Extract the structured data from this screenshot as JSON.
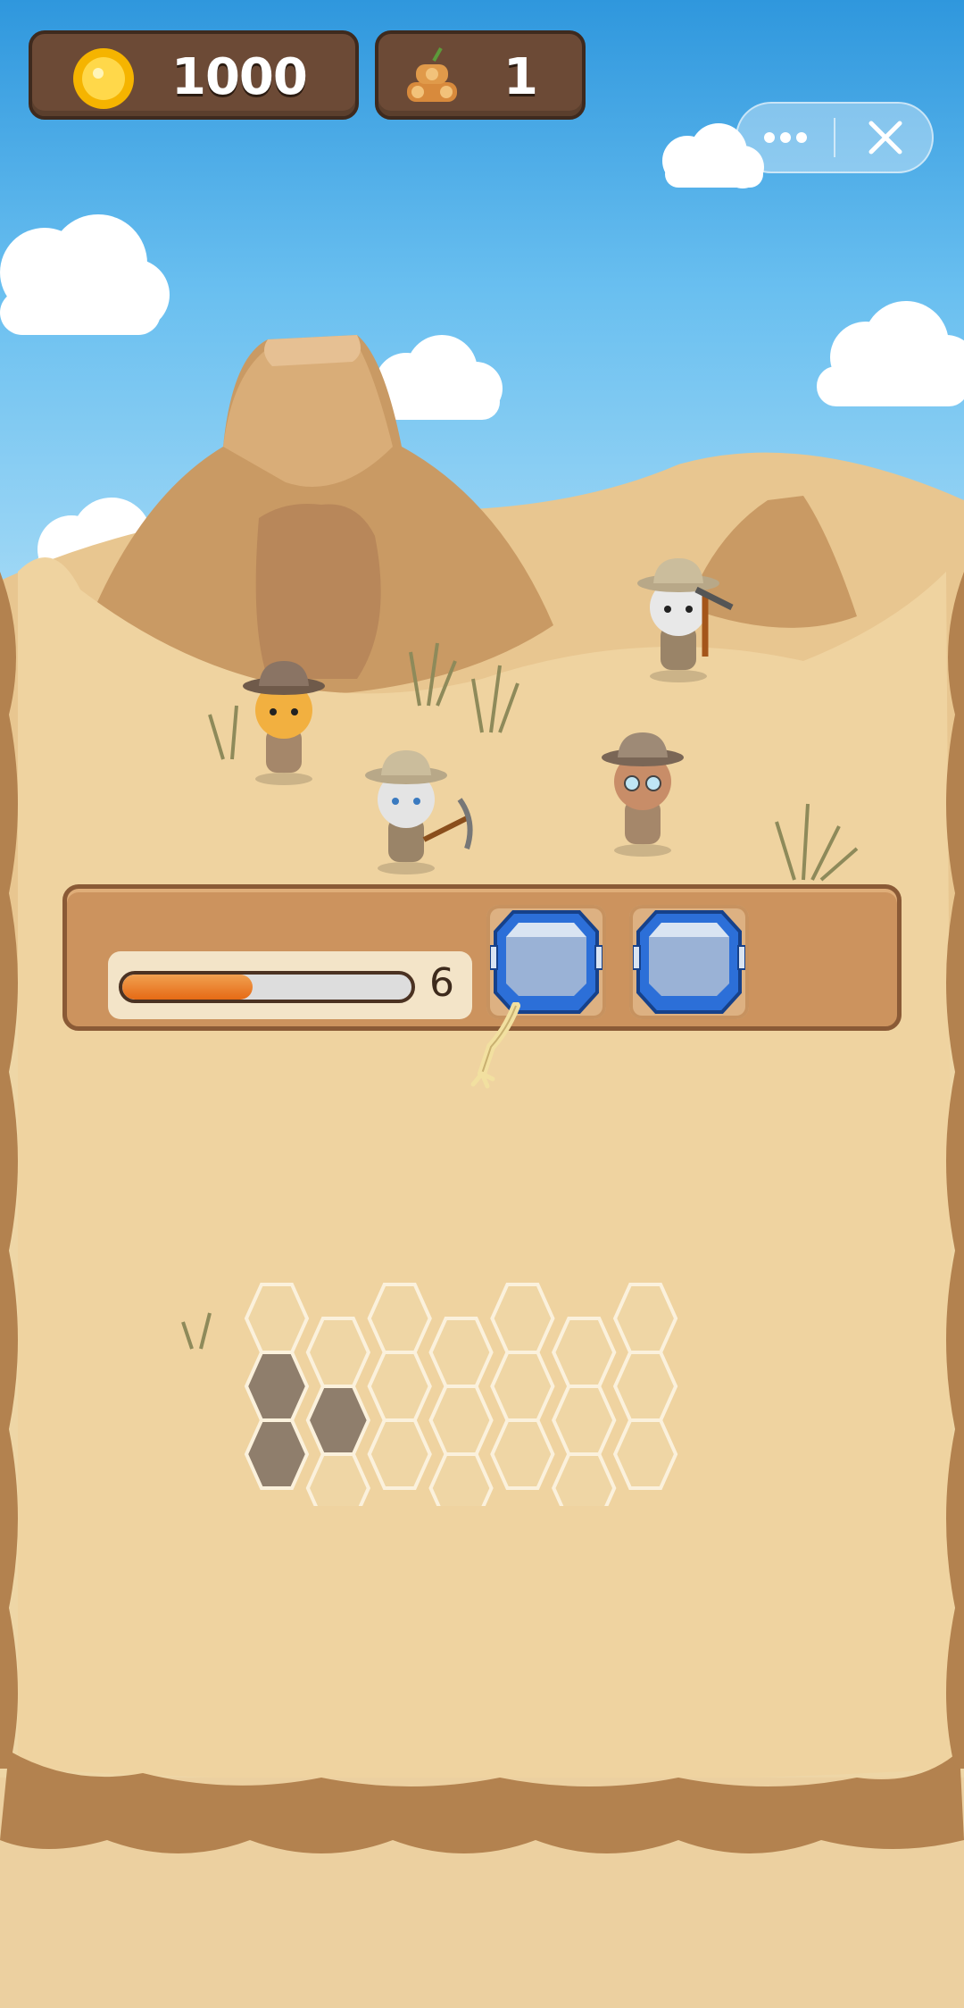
{
  "hud": {
    "coins": "1000",
    "coin_icon": "gold-coin-icon",
    "logs": "1",
    "log_icon": "wood-log-pile-icon"
  },
  "system_menu": {
    "more_icon": "more-dots-icon",
    "close_icon": "close-icon"
  },
  "dig_panel": {
    "progress": 0.45,
    "progress_count": "6",
    "slots": [
      {
        "item": "blue-crate-icon"
      },
      {
        "item": "blue-crate-icon"
      }
    ]
  },
  "colors": {
    "coin": "#f5b400",
    "hud_bg": "#6c4a36",
    "progress_fill": "#e66a15",
    "sand": "#eed6a6",
    "crate_blue": "#2c6fd8"
  }
}
